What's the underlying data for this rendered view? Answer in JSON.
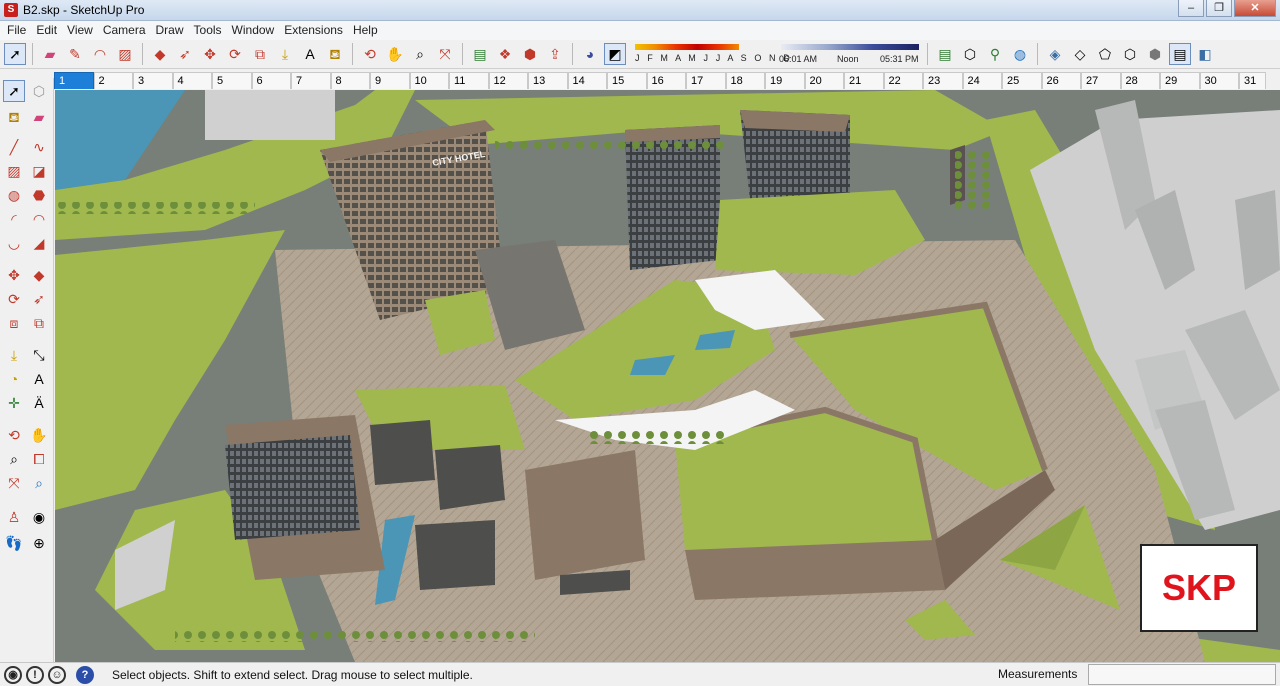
{
  "window": {
    "title": "B2.skp - SketchUp Pro",
    "app_icon": "sketchup-icon",
    "min": "–",
    "max": "❐",
    "close": "✕"
  },
  "menu": [
    "File",
    "Edit",
    "View",
    "Camera",
    "Draw",
    "Tools",
    "Window",
    "Extensions",
    "Help"
  ],
  "shadow_settings": {
    "months": "J F M A M J J A S O N D",
    "time_start": "06:01 AM",
    "time_mid": "Noon",
    "time_end": "05:31 PM"
  },
  "scenes": [
    "1",
    "2",
    "3",
    "4",
    "5",
    "6",
    "7",
    "8",
    "9",
    "10",
    "11",
    "12",
    "13",
    "14",
    "15",
    "16",
    "17",
    "18",
    "19",
    "20",
    "21",
    "22",
    "23",
    "24",
    "25",
    "26",
    "27",
    "28",
    "29",
    "30",
    "31"
  ],
  "active_scene": "1",
  "model_labels": {
    "hotel_sign": "CITY HOTEL",
    "watermark": "SKP"
  },
  "status": {
    "text": "Select objects. Shift to extend select. Drag mouse to select multiple.",
    "measurements_label": "Measurements"
  },
  "colors": {
    "grass": "#a1b84e",
    "road": "#777f78",
    "plaza": "#b3a694",
    "brick": "#8b7765",
    "water": "#4b95b6",
    "accent": "#1e7fd8",
    "logo_red": "#e0141c"
  }
}
